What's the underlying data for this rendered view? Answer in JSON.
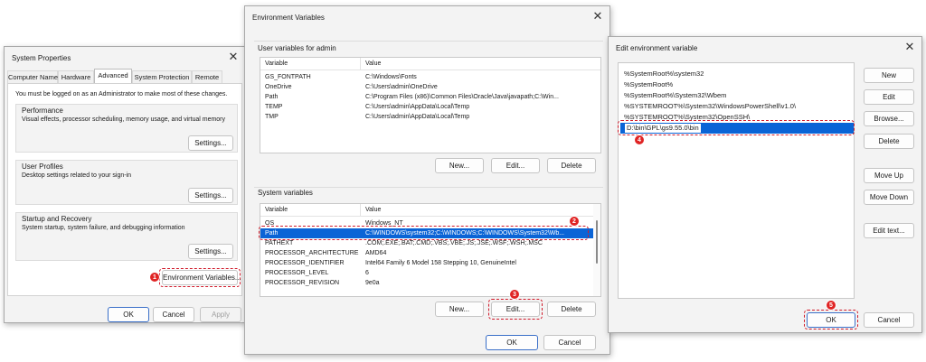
{
  "system_properties": {
    "title": "System Properties",
    "tabs": [
      "Computer Name",
      "Hardware",
      "Advanced",
      "System Protection",
      "Remote"
    ],
    "active_tab": "Advanced",
    "admin_note": "You must be logged on as an Administrator to make most of these changes.",
    "performance": {
      "label": "Performance",
      "desc": "Visual effects, processor scheduling, memory usage, and virtual memory",
      "button": "Settings..."
    },
    "user_profiles": {
      "label": "User Profiles",
      "desc": "Desktop settings related to your sign-in",
      "button": "Settings..."
    },
    "startup": {
      "label": "Startup and Recovery",
      "desc": "System startup, system failure, and debugging information",
      "button": "Settings..."
    },
    "env_button": "Environment Variables...",
    "ok": "OK",
    "cancel": "Cancel",
    "apply": "Apply"
  },
  "env_vars": {
    "title": "Environment Variables",
    "user_section": "User variables for admin",
    "columns": [
      "Variable",
      "Value"
    ],
    "user_vars": [
      {
        "name": "GS_FONTPATH",
        "value": "C:\\Windows\\Fonts"
      },
      {
        "name": "OneDrive",
        "value": "C:\\Users\\admin\\OneDrive"
      },
      {
        "name": "Path",
        "value": "C:\\Program Files (x86)\\Common Files\\Oracle\\Java\\javapath;C:\\Win..."
      },
      {
        "name": "TEMP",
        "value": "C:\\Users\\admin\\AppData\\Local\\Temp"
      },
      {
        "name": "TMP",
        "value": "C:\\Users\\admin\\AppData\\Local\\Temp"
      }
    ],
    "user_buttons": {
      "new": "New...",
      "edit": "Edit...",
      "delete": "Delete"
    },
    "system_section": "System variables",
    "system_vars": [
      {
        "name": "OS",
        "value": "Windows_NT"
      },
      {
        "name": "Path",
        "value": "C:\\WINDOWS\\system32;C:\\WINDOWS;C:\\WINDOWS\\System32\\Wb..."
      },
      {
        "name": "PATHEXT",
        "value": ".COM;.EXE;.BAT;.CMD;.VBS;.VBE;.JS;.JSE;.WSF;.WSH;.MSC"
      },
      {
        "name": "PROCESSOR_ARCHITECTURE",
        "value": "AMD64"
      },
      {
        "name": "PROCESSOR_IDENTIFIER",
        "value": "Intel64 Family 6 Model 158 Stepping 10, GenuineIntel"
      },
      {
        "name": "PROCESSOR_LEVEL",
        "value": "6"
      },
      {
        "name": "PROCESSOR_REVISION",
        "value": "9e0a"
      }
    ],
    "system_buttons": {
      "new": "New...",
      "edit": "Edit...",
      "delete": "Delete"
    },
    "ok": "OK",
    "cancel": "Cancel"
  },
  "edit_env": {
    "title": "Edit environment variable",
    "paths": [
      "%SystemRoot%\\system32",
      "%SystemRoot%",
      "%SystemRoot%\\System32\\Wbem",
      "%SYSTEMROOT%\\System32\\WindowsPowerShell\\v1.0\\",
      "%SYSTEMROOT%\\System32\\OpenSSH\\"
    ],
    "new_path_value": "D:\\bin\\GPL\\gs9.55.0\\bin",
    "buttons": {
      "new": "New",
      "edit": "Edit",
      "browse": "Browse...",
      "delete": "Delete",
      "move_up": "Move Up",
      "move_down": "Move Down",
      "edit_text": "Edit text..."
    },
    "ok": "OK",
    "cancel": "Cancel"
  },
  "steps": [
    "1",
    "2",
    "3",
    "4",
    "5"
  ],
  "colors": {
    "selection": "#0a64d6",
    "callout": "#d11a2a",
    "badge": "#e02424"
  }
}
